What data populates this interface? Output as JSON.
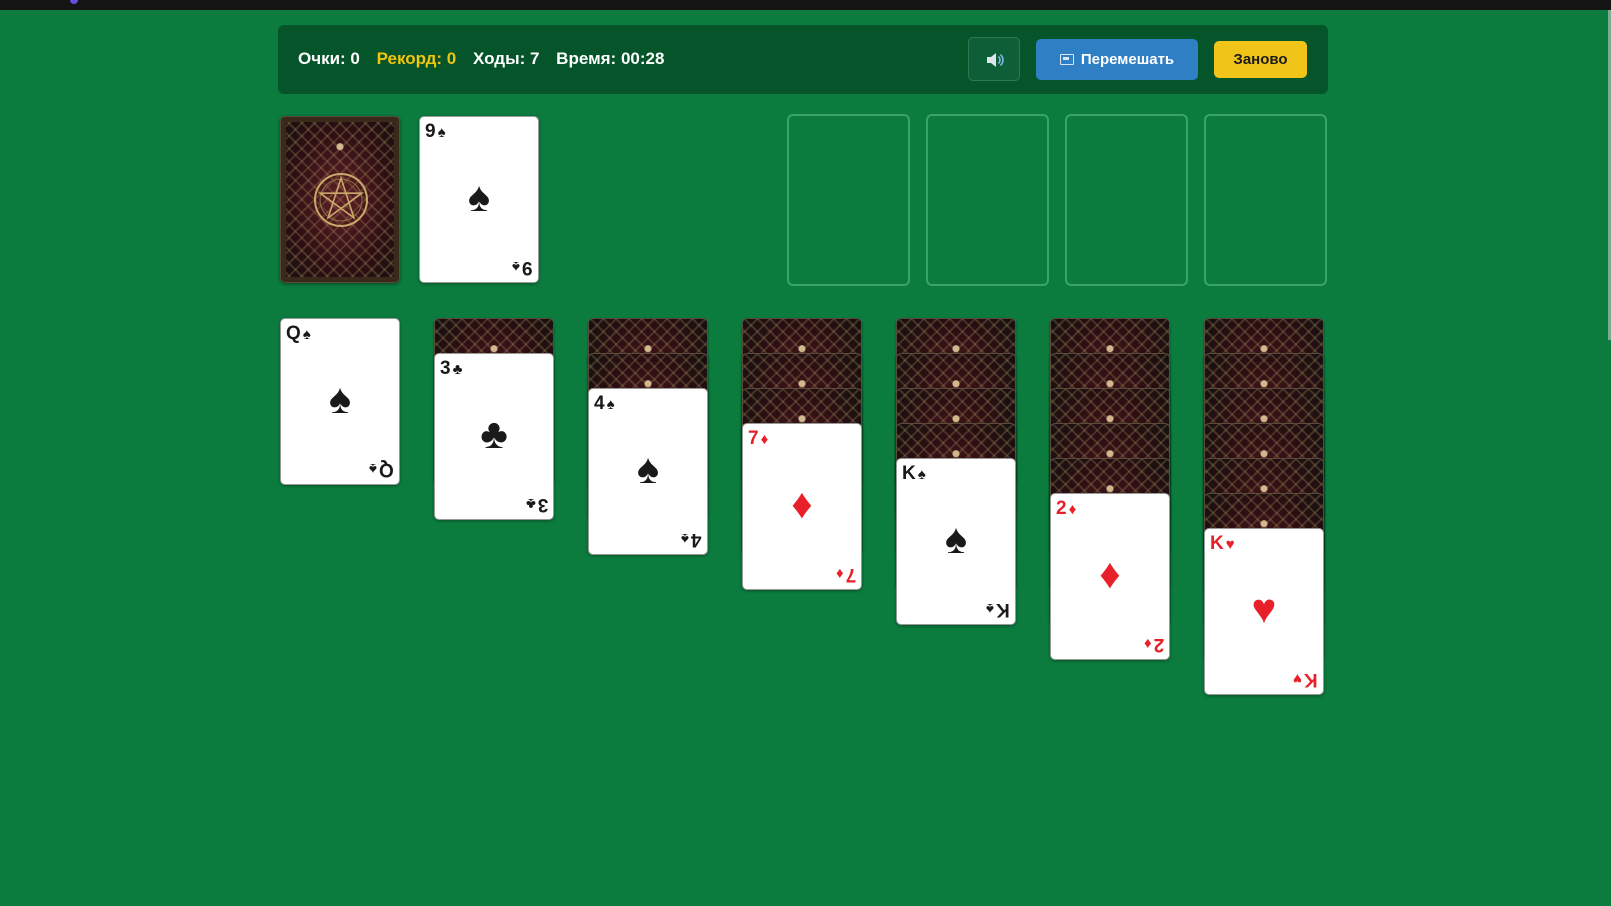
{
  "header": {
    "score_label": "Очки: 0",
    "record_label": "Рекорд: 0",
    "moves_label": "Ходы: 7",
    "time_label": "Время: 00:28",
    "shuffle_label": "Перемешать",
    "restart_label": "Заново"
  },
  "colors": {
    "table": "#0b7c3e",
    "header": "#05542a",
    "record": "#f1c40f",
    "shuffle_button": "#2f7fc5",
    "restart_button": "#f0c419",
    "red_suit": "#e8202a"
  },
  "icons": {
    "sound": "speaker-icon",
    "shuffle": "shuffle-icon"
  },
  "waste": {
    "rank": "9",
    "suit": "♠",
    "color": "black"
  },
  "foundations": [
    null,
    null,
    null,
    null
  ],
  "tableau": [
    {
      "hidden": 0,
      "top": {
        "rank": "Q",
        "suit": "♠",
        "color": "black"
      }
    },
    {
      "hidden": 1,
      "top": {
        "rank": "3",
        "suit": "♣",
        "color": "black"
      }
    },
    {
      "hidden": 2,
      "top": {
        "rank": "4",
        "suit": "♠",
        "color": "black"
      }
    },
    {
      "hidden": 3,
      "top": {
        "rank": "7",
        "suit": "♦",
        "color": "red"
      }
    },
    {
      "hidden": 4,
      "top": {
        "rank": "K",
        "suit": "♠",
        "color": "black"
      }
    },
    {
      "hidden": 5,
      "top": {
        "rank": "2",
        "suit": "♦",
        "color": "red"
      }
    },
    {
      "hidden": 6,
      "top": {
        "rank": "K",
        "suit": "♥",
        "color": "red"
      }
    }
  ]
}
